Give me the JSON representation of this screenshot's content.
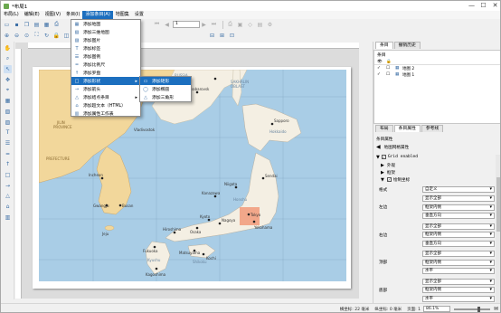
{
  "window": {
    "title": "*布局1",
    "min": "—",
    "max": "☐",
    "close": "✕"
  },
  "menubar": [
    "布局(L)",
    "编辑(E)",
    "视图(V)",
    "条目(I)",
    "添加条目(A)",
    "地图集",
    "设置"
  ],
  "menubar_active_index": 4,
  "toolbar": {
    "page_field": "1"
  },
  "add_item_menu": [
    {
      "label": "添加地图",
      "icon": "map-icon"
    },
    {
      "label": "添加三维地图",
      "icon": "3d-map-icon"
    },
    {
      "label": "添加图片",
      "icon": "picture-icon"
    },
    {
      "label": "添加标签",
      "icon": "label-icon"
    },
    {
      "label": "添加图例",
      "icon": "legend-icon"
    },
    {
      "label": "添加比例尺",
      "icon": "scalebar-icon"
    },
    {
      "label": "添加罗盘",
      "icon": "north-arrow-icon"
    },
    {
      "label": "添加形状",
      "icon": "shape-icon",
      "submenu": true
    },
    {
      "label": "添加箭头",
      "icon": "arrow-icon"
    },
    {
      "label": "添加结点条目",
      "icon": "node-icon",
      "submenu": true
    },
    {
      "label": "添加超文本（HTML）",
      "icon": "html-icon"
    },
    {
      "label": "添加属性工作表",
      "icon": "table-icon"
    }
  ],
  "add_item_menu_highlight_index": 7,
  "shape_submenu": [
    {
      "label": "添加矩形",
      "icon": "rectangle-icon"
    },
    {
      "label": "添加椭圆",
      "icon": "ellipse-icon"
    },
    {
      "label": "添加三角形",
      "icon": "triangle-icon"
    }
  ],
  "map": {
    "labels": [
      {
        "t": "RUSSIA",
        "k": "sea"
      },
      {
        "t": "SAKHALIN",
        "k": "sea"
      },
      {
        "t": "OBLAST",
        "k": "sea"
      },
      {
        "t": "Sapporo",
        "k": "city"
      },
      {
        "t": "Hokkaido",
        "k": "pref"
      },
      {
        "t": "Sendai",
        "k": "city"
      },
      {
        "t": "Tokyo",
        "k": "city"
      },
      {
        "t": "Kyoto",
        "k": "city"
      },
      {
        "t": "Osaka",
        "k": "city"
      },
      {
        "t": "Hiroshima",
        "k": "city"
      },
      {
        "t": "Fukuoka",
        "k": "city"
      },
      {
        "t": "Kagoshima",
        "k": "city"
      },
      {
        "t": "Incheon",
        "k": "city"
      },
      {
        "t": "Busan",
        "k": "city"
      },
      {
        "t": "Gwangju",
        "k": "city"
      },
      {
        "t": "Jeju",
        "k": "city"
      },
      {
        "t": "Nagoya",
        "k": "city"
      },
      {
        "t": "Niigata",
        "k": "city"
      },
      {
        "t": "Kanazawa",
        "k": "city"
      },
      {
        "t": "Matsuyama",
        "k": "city"
      },
      {
        "t": "Kochi",
        "k": "city"
      },
      {
        "t": "Yokohama",
        "k": "city"
      },
      {
        "t": "JILIN",
        "k": "pref"
      },
      {
        "t": "PROVINCE",
        "k": "pref"
      },
      {
        "t": "PREFECTURE",
        "k": "pref"
      },
      {
        "t": "Vladivostok",
        "k": "city"
      },
      {
        "t": "Khabarovsk",
        "k": "city"
      },
      {
        "t": "Honshu",
        "k": "pref"
      },
      {
        "t": "Shikoku",
        "k": "pref"
      },
      {
        "t": "Kyushu",
        "k": "pref"
      }
    ]
  },
  "items_panel": {
    "tabs": [
      "条目",
      "撤销历史"
    ],
    "header": "条目",
    "rows": [
      {
        "checked": true,
        "name": "地图 2"
      },
      {
        "checked": true,
        "name": "地图 1"
      }
    ]
  },
  "props_panel": {
    "tabs": [
      "布局",
      "条目属性",
      "参考线"
    ],
    "header": "条目属性",
    "title": "地图网格属性",
    "sections": [
      {
        "label": "Grid enabled",
        "type": "checkbox"
      },
      {
        "label": "外观",
        "type": "section"
      },
      {
        "label": "框架",
        "type": "section"
      },
      {
        "label": "绘制坐标",
        "type": "section-open"
      }
    ],
    "format_label": "格式",
    "format_value": "自定义",
    "groups": [
      {
        "label": "左边",
        "values": [
          "显示全部",
          "框架内侧",
          "垂直方向"
        ]
      },
      {
        "label": "右边",
        "values": [
          "显示全部",
          "框架内侧",
          "垂直方向"
        ]
      },
      {
        "label": "顶部",
        "values": [
          "显示全部",
          "框架内侧",
          "水平"
        ]
      },
      {
        "label": "底部",
        "values": [
          "显示全部",
          "框架内侧",
          "水平"
        ]
      }
    ]
  },
  "status": {
    "x": "横坐标: 22 毫米",
    "y": "纵坐标: 0 毫米",
    "page": "页面: 1",
    "zoom": "86.1%"
  },
  "colors": {
    "accent": "#1c6fbf",
    "sea": "#a9cde6",
    "land": "#f4efe3",
    "neighbor": "#f2d79b",
    "highlight": "#f19a7a"
  }
}
